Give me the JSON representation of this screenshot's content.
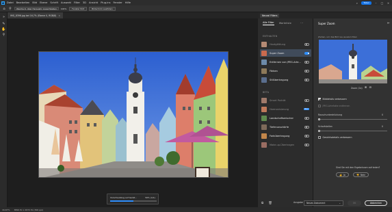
{
  "app": {
    "logo": "Ps",
    "menu": [
      "Datei",
      "Bearbeiten",
      "Bild",
      "Ebene",
      "Schrift",
      "Auswahl",
      "Filter",
      "3D",
      "Ansicht",
      "Plug-ins",
      "Fenster",
      "Hilfe"
    ],
    "share_label": "Teilen"
  },
  "options_bar": {
    "field_value": "Weiche K. über Heraushr. Ausschließen",
    "zoom_value": "100%",
    "fit_label": "Fenster füllt",
    "fill_label": "Bildschirm ausfüllen"
  },
  "document": {
    "tab_title": "IMG_8396.jpg bei 16,7% (Ebene 0, RGB/8)",
    "close_glyph": "×"
  },
  "progress": {
    "label": "Vorschaubzug auf Gerät...",
    "percent_text": "50% (1/1)",
    "value": 0.5
  },
  "status_bar": {
    "zoom": "16,67%",
    "size": "3899 Px x 2672 Px (300 ppi)"
  },
  "neural_filters": {
    "header_tab": "Neural Filters",
    "tabs": [
      "Alle Filter",
      "Warteliste"
    ],
    "more_glyph": "···",
    "section_enthalten": "ENTHALTEN",
    "section_beta": "BETA",
    "filters_enthalten": [
      {
        "name": "Hautglättung",
        "dim": true,
        "toggle": false
      },
      {
        "name": "Super Zoom",
        "dim": false,
        "toggle": true,
        "selected": true
      },
      {
        "name": "Entfernen von JPEG-Arte...",
        "dim": false,
        "toggle": false
      },
      {
        "name": "Färben",
        "dim": false,
        "toggle": false
      },
      {
        "name": "Stilübertragung",
        "dim": false,
        "toggle": false
      }
    ],
    "filters_beta": [
      {
        "name": "Smart Porträt",
        "dim": true,
        "toggle": false
      },
      {
        "name": "Harmonisierung",
        "dim": true,
        "badge": "Neu"
      },
      {
        "name": "Landschaftsmischer",
        "dim": false,
        "toggle": false
      },
      {
        "name": "Tiefenunschärfe",
        "dim": false,
        "toggle": false
      },
      {
        "name": "Farbübertragung",
        "dim": false,
        "toggle": false
      },
      {
        "name": "Make-up-Übertragen",
        "dim": true,
        "toggle": false
      }
    ]
  },
  "settings": {
    "title": "Super Zoom",
    "description": "Ziehen, um das Bild neu auszurichten",
    "zoom_label": "Zoom (2x)",
    "checkbox_details": "Bilddetails verbessern",
    "checkbox_jpeg": "JPEG-Artefakte entfernen",
    "slider_noise_label": "Rauschunterdrückung",
    "slider_noise_value": 0,
    "slider_sharpen_label": "Scharfstellen",
    "slider_sharpen_value": 0,
    "checkbox_face": "Gesichtsdetails verbessern",
    "feedback_question": "Sind Sie mit den Ergebnissen zufrieden?",
    "yes_label": "Ja",
    "no_label": "Nein"
  },
  "footer": {
    "output_label": "Ausgabe",
    "output_value": "Neues Dokument",
    "ok_label": "OK",
    "cancel_label": "Abbrechen"
  },
  "colors": {
    "accent": "#2f8fff",
    "sky": "#3d6fd6"
  }
}
